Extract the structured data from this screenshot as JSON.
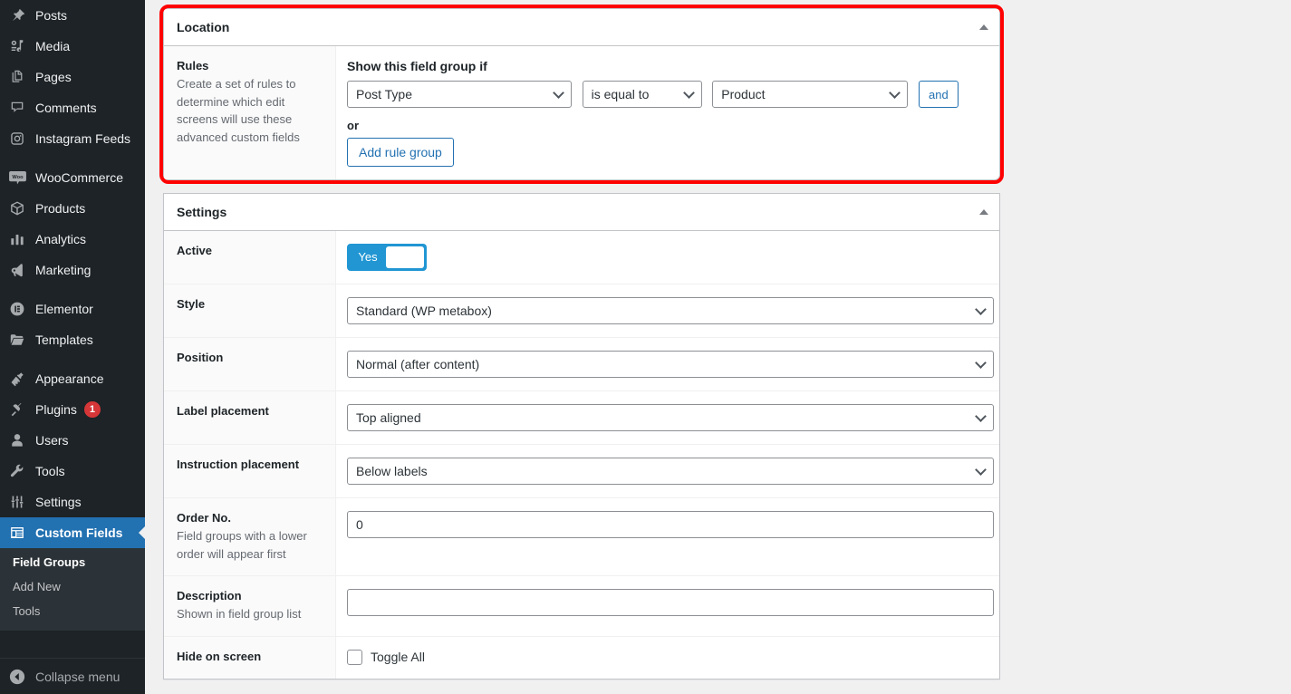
{
  "sidebar": {
    "items": [
      {
        "label": "Posts",
        "icon": "pin-icon",
        "name": "sidebar-item-posts",
        "current": false
      },
      {
        "label": "Media",
        "icon": "media-icon",
        "name": "sidebar-item-media",
        "current": false
      },
      {
        "label": "Pages",
        "icon": "pages-icon",
        "name": "sidebar-item-pages",
        "current": false
      },
      {
        "label": "Comments",
        "icon": "comments-icon",
        "name": "sidebar-item-comments",
        "current": false
      },
      {
        "label": "Instagram Feeds",
        "icon": "instagram-icon",
        "name": "sidebar-item-instagram-feeds",
        "current": false
      },
      {
        "separator": true
      },
      {
        "label": "WooCommerce",
        "icon": "woocommerce-icon",
        "name": "sidebar-item-woocommerce",
        "current": false
      },
      {
        "label": "Products",
        "icon": "products-icon",
        "name": "sidebar-item-products",
        "current": false
      },
      {
        "label": "Analytics",
        "icon": "analytics-icon",
        "name": "sidebar-item-analytics",
        "current": false
      },
      {
        "label": "Marketing",
        "icon": "marketing-icon",
        "name": "sidebar-item-marketing",
        "current": false
      },
      {
        "separator": true
      },
      {
        "label": "Elementor",
        "icon": "elementor-icon",
        "name": "sidebar-item-elementor",
        "current": false
      },
      {
        "label": "Templates",
        "icon": "templates-icon",
        "name": "sidebar-item-templates",
        "current": false
      },
      {
        "separator": true
      },
      {
        "label": "Appearance",
        "icon": "appearance-icon",
        "name": "sidebar-item-appearance",
        "current": false
      },
      {
        "label": "Plugins",
        "icon": "plugins-icon",
        "name": "sidebar-item-plugins",
        "current": false,
        "badge": "1"
      },
      {
        "label": "Users",
        "icon": "users-icon",
        "name": "sidebar-item-users",
        "current": false
      },
      {
        "label": "Tools",
        "icon": "tools-icon",
        "name": "sidebar-item-tools",
        "current": false
      },
      {
        "label": "Settings",
        "icon": "settings-icon",
        "name": "sidebar-item-settings",
        "current": false
      },
      {
        "label": "Custom Fields",
        "icon": "custom-fields-icon",
        "name": "sidebar-item-custom-fields",
        "current": true
      }
    ],
    "submenu": [
      {
        "label": "Field Groups",
        "name": "submenu-item-field-groups",
        "current": true
      },
      {
        "label": "Add New",
        "name": "submenu-item-add-new",
        "current": false
      },
      {
        "label": "Tools",
        "name": "submenu-item-tools",
        "current": false
      }
    ],
    "collapse_label": "Collapse menu",
    "accent_color": "#2271b1",
    "background_color": "#1d2327",
    "badge_color": "#d63638"
  },
  "location_panel": {
    "title": "Location",
    "highlight_color": "#ff0000",
    "rules": {
      "title": "Rules",
      "description": "Create a set of rules to determine which edit screens will use these advanced custom fields"
    },
    "show_if_label": "Show this field group if",
    "param_select": "Post Type",
    "operator_select": "is equal to",
    "value_select": "Product",
    "and_button": "and",
    "or_label": "or",
    "add_rule_group_button": "Add rule group"
  },
  "settings_panel": {
    "title": "Settings",
    "rows": [
      {
        "label": "Active",
        "desc": "",
        "control": "toggle",
        "value": "Yes",
        "name": "active-toggle"
      },
      {
        "label": "Style",
        "desc": "",
        "control": "select",
        "value": "Standard (WP metabox)",
        "name": "style-select"
      },
      {
        "label": "Position",
        "desc": "",
        "control": "select",
        "value": "Normal (after content)",
        "name": "position-select"
      },
      {
        "label": "Label placement",
        "desc": "",
        "control": "select",
        "value": "Top aligned",
        "name": "label-placement-select"
      },
      {
        "label": "Instruction placement",
        "desc": "",
        "control": "select",
        "value": "Below labels",
        "name": "instruction-placement-select"
      },
      {
        "label": "Order No.",
        "desc": "Field groups with a lower order will appear first",
        "control": "text",
        "value": "0",
        "placeholder": "",
        "name": "order-no-input"
      },
      {
        "label": "Description",
        "desc": "Shown in field group list",
        "control": "text",
        "value": "",
        "placeholder": "",
        "name": "description-input"
      },
      {
        "label": "Hide on screen",
        "desc": "",
        "control": "checkbox",
        "value": "Toggle All",
        "name": "hide-on-screen-toggle-all"
      }
    ]
  }
}
